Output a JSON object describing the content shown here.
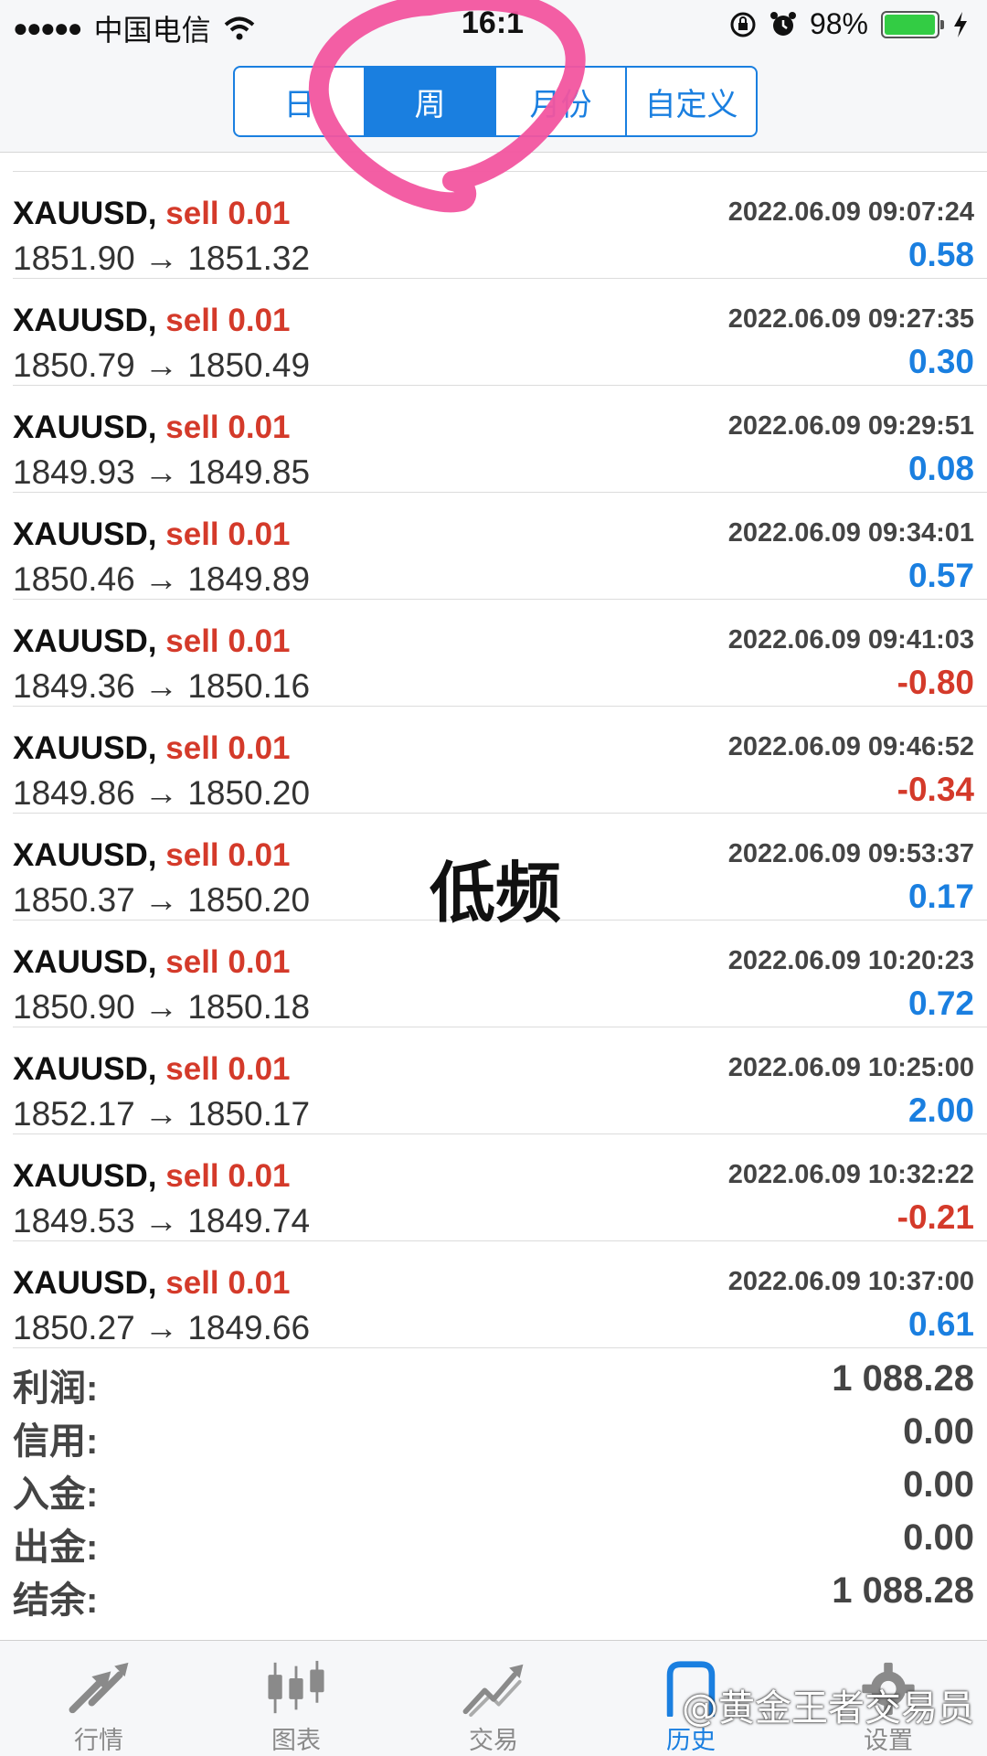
{
  "status_bar": {
    "signal": "●●●●●",
    "carrier": "中国电信",
    "time": "16:1",
    "battery": "98%",
    "battery_level": 0.98
  },
  "segmented": {
    "tabs": [
      {
        "label": "日",
        "active": false
      },
      {
        "label": "周",
        "active": true
      },
      {
        "label": "月份",
        "active": false
      },
      {
        "label": "自定义",
        "active": false
      }
    ]
  },
  "trades": [
    {
      "symbol": "XAUUSD,",
      "type": "sell",
      "volume": "0.01",
      "open": "1851.90",
      "close": "1851.32",
      "time": "2022.06.09 09:07:24",
      "profit": "0.58",
      "negative": false
    },
    {
      "symbol": "XAUUSD,",
      "type": "sell",
      "volume": "0.01",
      "open": "1850.79",
      "close": "1850.49",
      "time": "2022.06.09 09:27:35",
      "profit": "0.30",
      "negative": false
    },
    {
      "symbol": "XAUUSD,",
      "type": "sell",
      "volume": "0.01",
      "open": "1849.93",
      "close": "1849.85",
      "time": "2022.06.09 09:29:51",
      "profit": "0.08",
      "negative": false
    },
    {
      "symbol": "XAUUSD,",
      "type": "sell",
      "volume": "0.01",
      "open": "1850.46",
      "close": "1849.89",
      "time": "2022.06.09 09:34:01",
      "profit": "0.57",
      "negative": false
    },
    {
      "symbol": "XAUUSD,",
      "type": "sell",
      "volume": "0.01",
      "open": "1849.36",
      "close": "1850.16",
      "time": "2022.06.09 09:41:03",
      "profit": "-0.80",
      "negative": true
    },
    {
      "symbol": "XAUUSD,",
      "type": "sell",
      "volume": "0.01",
      "open": "1849.86",
      "close": "1850.20",
      "time": "2022.06.09 09:46:52",
      "profit": "-0.34",
      "negative": true
    },
    {
      "symbol": "XAUUSD,",
      "type": "sell",
      "volume": "0.01",
      "open": "1850.37",
      "close": "1850.20",
      "time": "2022.06.09 09:53:37",
      "profit": "0.17",
      "negative": false
    },
    {
      "symbol": "XAUUSD,",
      "type": "sell",
      "volume": "0.01",
      "open": "1850.90",
      "close": "1850.18",
      "time": "2022.06.09 10:20:23",
      "profit": "0.72",
      "negative": false
    },
    {
      "symbol": "XAUUSD,",
      "type": "sell",
      "volume": "0.01",
      "open": "1852.17",
      "close": "1850.17",
      "time": "2022.06.09 10:25:00",
      "profit": "2.00",
      "negative": false
    },
    {
      "symbol": "XAUUSD,",
      "type": "sell",
      "volume": "0.01",
      "open": "1849.53",
      "close": "1849.74",
      "time": "2022.06.09 10:32:22",
      "profit": "-0.21",
      "negative": true
    },
    {
      "symbol": "XAUUSD,",
      "type": "sell",
      "volume": "0.01",
      "open": "1850.27",
      "close": "1849.66",
      "time": "2022.06.09 10:37:00",
      "profit": "0.61",
      "negative": false
    }
  ],
  "overlay_note": "低频",
  "summary": [
    {
      "label": "利润:",
      "value": "1 088.28"
    },
    {
      "label": "信用:",
      "value": "0.00"
    },
    {
      "label": "入金:",
      "value": "0.00"
    },
    {
      "label": "出金:",
      "value": "0.00"
    },
    {
      "label": "结余:",
      "value": "1 088.28"
    }
  ],
  "tabbar": [
    {
      "label": "行情",
      "icon": "quotes-arrows-icon",
      "active": false
    },
    {
      "label": "图表",
      "icon": "candlestick-chart-icon",
      "active": false
    },
    {
      "label": "交易",
      "icon": "trade-trend-icon",
      "active": false
    },
    {
      "label": "历史",
      "icon": "history-folder-icon",
      "active": true
    },
    {
      "label": "设置",
      "icon": "gear-icon",
      "active": false
    }
  ],
  "watermark": "@黄金王者交易员",
  "colors": {
    "accent": "#1a7fe0",
    "sell": "#d43a2a",
    "annotation": "#f2559f"
  }
}
